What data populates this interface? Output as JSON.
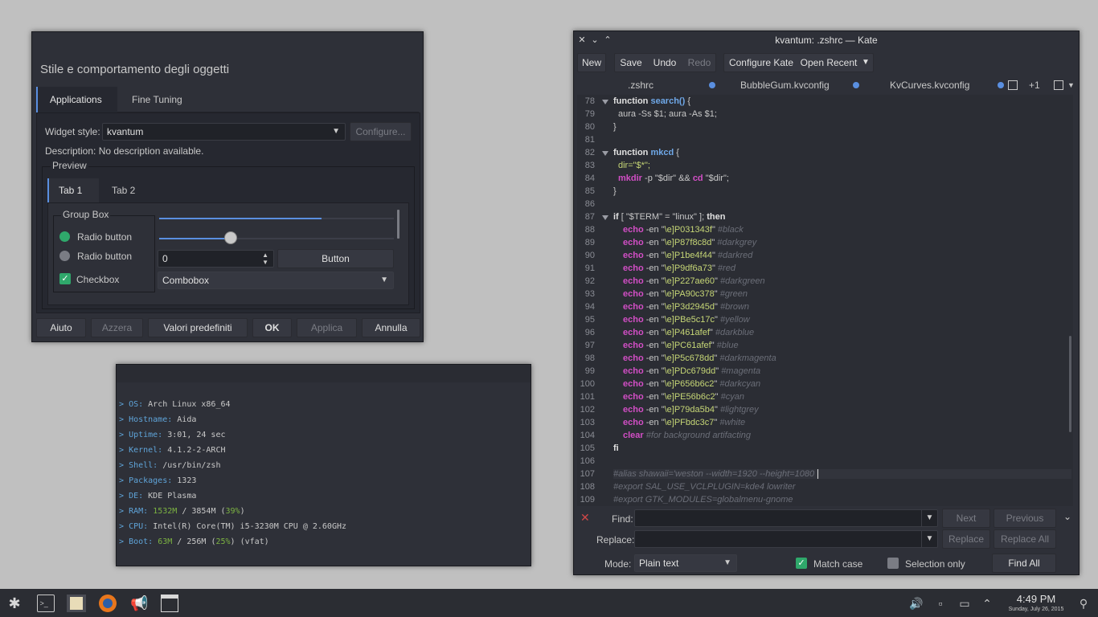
{
  "settings": {
    "title": "Stile e comportamento degli oggetti",
    "tabs": [
      "Applications",
      "Fine Tuning"
    ],
    "widget_style_label": "Widget style:",
    "widget_style_value": "kvantum",
    "configure_label": "Configure...",
    "description": "Description: No description available.",
    "preview_label": "Preview",
    "preview_tabs": [
      "Tab 1",
      "Tab 2"
    ],
    "group_box_label": "Group Box",
    "radio1": "Radio button",
    "radio2": "Radio button",
    "checkbox": "Checkbox",
    "spin_value": "0",
    "button_label": "Button",
    "combobox_value": "Combobox",
    "buttons": {
      "help": "Aiuto",
      "reset": "Azzera",
      "defaults": "Valori predefiniti",
      "ok": "OK",
      "apply": "Applica",
      "cancel": "Annulla"
    }
  },
  "terminal": {
    "lines": [
      {
        "key": "OS:",
        "value": "Arch Linux x86_64"
      },
      {
        "key": "Hostname:",
        "value": "Aida"
      },
      {
        "key": "Uptime:",
        "value": "3:01, 24 sec"
      },
      {
        "key": "Kernel:",
        "value": "4.1.2-2-ARCH"
      },
      {
        "key": "Shell:",
        "value": "/usr/bin/zsh"
      },
      {
        "key": "Packages:",
        "value": "1323"
      },
      {
        "key": "DE:",
        "value": "KDE Plasma"
      },
      {
        "key": "RAM:",
        "value": "",
        "ram_used": "1532M",
        "ram_total": "3854M",
        "ram_pct": "39%"
      },
      {
        "key": "CPU:",
        "value": "Intel(R) Core(TM) i5-3230M CPU @ 2.60GHz"
      },
      {
        "key": "Boot:",
        "value": "",
        "boot_used": "63M",
        "boot_total": "256M",
        "boot_pct": "25%",
        "boot_fs": "(vfat)"
      }
    ],
    "prompt": ">"
  },
  "kate": {
    "title": "kvantum: .zshrc  — Kate",
    "toolbar": {
      "new": "New",
      "save": "Save",
      "undo": "Undo",
      "redo": "Redo",
      "configure": "Configure Kate",
      "open_recent": "Open Recent"
    },
    "tabs": [
      ".zshrc",
      "BubbleGum.kvconfig",
      "KvCurves.kvconfig"
    ],
    "tabs_more": "+1",
    "line_numbers": [
      "78",
      "79",
      "80",
      "81",
      "82",
      "83",
      "84",
      "85",
      "86",
      "87",
      "88",
      "89",
      "90",
      "91",
      "92",
      "93",
      "94",
      "95",
      "96",
      "97",
      "98",
      "99",
      "100",
      "101",
      "102",
      "103",
      "104",
      "105",
      "106",
      "107",
      "108",
      "109"
    ],
    "echo_lines": [
      {
        "code": "\\e]P031343f",
        "comment": "#black"
      },
      {
        "code": "\\e]P87f8c8d",
        "comment": "#darkgrey"
      },
      {
        "code": "\\e]P1be4f44",
        "comment": "#darkred"
      },
      {
        "code": "\\e]P9df6a73",
        "comment": "#red"
      },
      {
        "code": "\\e]P227ae60",
        "comment": "#darkgreen"
      },
      {
        "code": "\\e]PA90c378",
        "comment": "#green"
      },
      {
        "code": "\\e]P3d2945d",
        "comment": "#brown"
      },
      {
        "code": "\\e]PBe5c17c",
        "comment": "#yellow"
      },
      {
        "code": "\\e]P461afef",
        "comment": "#darkblue"
      },
      {
        "code": "\\e]PC61afef",
        "comment": "#blue"
      },
      {
        "code": "\\e]P5c678dd",
        "comment": "#darkmagenta"
      },
      {
        "code": "\\e]PDc679dd",
        "comment": "#magenta"
      },
      {
        "code": "\\e]P656b6c2",
        "comment": "#darkcyan"
      },
      {
        "code": "\\e]PE56b6c2",
        "comment": "#cyan"
      },
      {
        "code": "\\e]P79da5b4",
        "comment": "#lightgrey"
      },
      {
        "code": "\\e]PFbdc3c7",
        "comment": "#white"
      }
    ],
    "code_text": {
      "search_kw": "function",
      "search_fn": "search()",
      "search_body": "aura -Ss $1; aura -As $1;",
      "mkcd_fn": "mkcd",
      "dir_assign": "dir=\"$*\";",
      "mkdir_line_cmd": "mkdir",
      "mkdir_line_rest": " -p \"$dir\" && ",
      "cd_cmd": "cd",
      "cd_rest": " \"$dir\";",
      "if_line_kw": "if",
      "if_line_rest": " [ \"$TERM\" = \"linux\" ]; ",
      "then_kw": "then",
      "echo_kw": "echo",
      "echo_opt": " -en ",
      "clear_kw": "clear",
      "clear_comment": "#for background artifacting",
      "fi_kw": "fi",
      "l107": "#alias shawaii='weston --width=1920 --height=1080",
      "l108": "#export SAL_USE_VCLPLUGIN=kde4 lowriter",
      "l109": "#export GTK_MODULES=globalmenu-gnome",
      "brace_open": "{",
      "brace_close": "}"
    },
    "find": {
      "find_label": "Find:",
      "replace_label": "Replace:",
      "next": "Next",
      "previous": "Previous",
      "replace": "Replace",
      "replace_all": "Replace All",
      "mode_label": "Mode:",
      "mode_value": "Plain text",
      "match_case": "Match case",
      "selection_only": "Selection only",
      "find_all": "Find All"
    }
  },
  "taskbar": {
    "time": "4:49 PM",
    "date": "Sunday, July 26, 2015"
  },
  "colors": {
    "accent": "#5a8fe0",
    "green": "#2fa86b",
    "keyword_magenta": "#d24ec5"
  }
}
